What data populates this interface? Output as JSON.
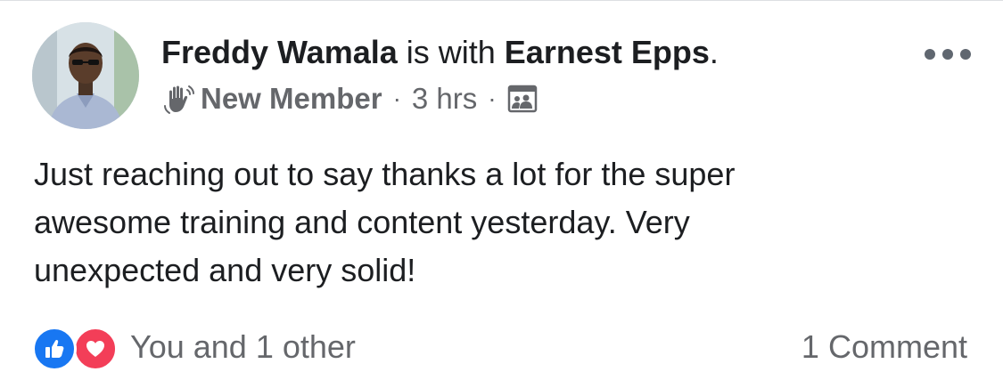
{
  "post": {
    "author": "Freddy Wamala",
    "with_text": " is with ",
    "tagged": "Earnest Epps",
    "title_end": ".",
    "badge": "New Member",
    "separator": "·",
    "time": "3 hrs",
    "audience_icon": "group-audience-icon",
    "badge_icon": "wave-icon",
    "body": "Just reaching out to say thanks a lot for the super\nawesome training and content yesterday. Very\nunexpected and very solid!"
  },
  "footer": {
    "reactions_text": "You and 1 other",
    "comments_text": "1 Comment",
    "reaction_icons": [
      "like-icon",
      "love-icon"
    ]
  },
  "colors": {
    "text": "#1c1e21",
    "muted": "#65676b",
    "like": "#1877f2",
    "love": "#f33e58"
  }
}
